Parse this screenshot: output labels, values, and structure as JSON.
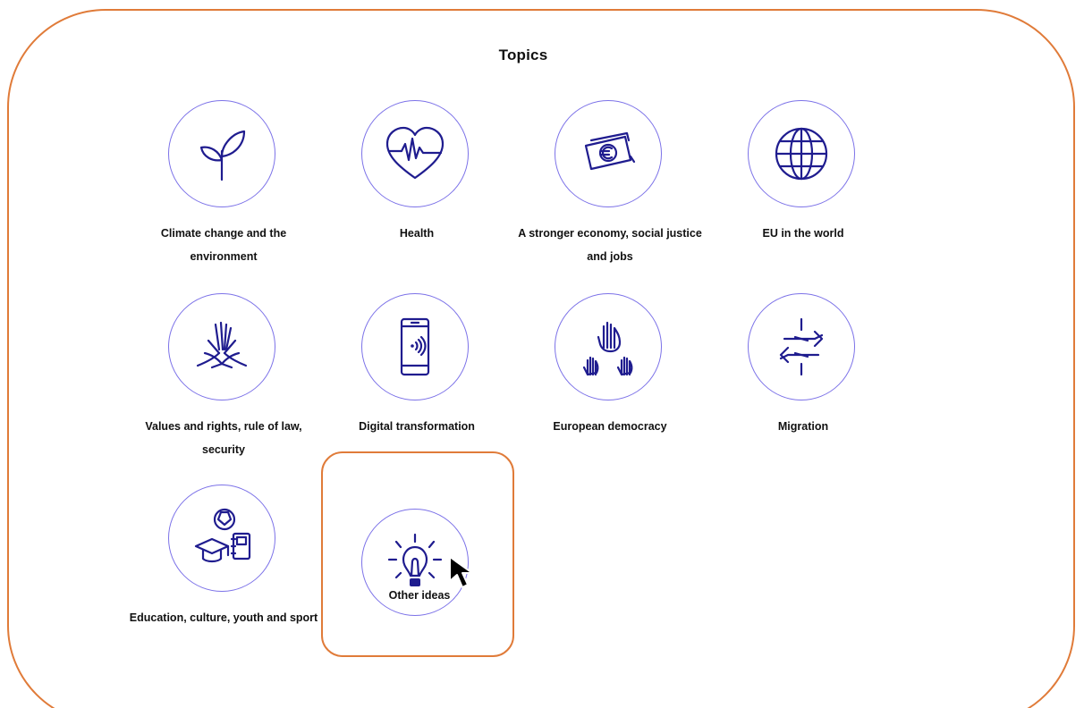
{
  "page": {
    "title": "Topics"
  },
  "colors": {
    "frame": "#e07b39",
    "circle": "#7c72e8",
    "icon": "#1f1c8f"
  },
  "topics": [
    {
      "label": "Climate change and the environment",
      "icon": "sprout-icon"
    },
    {
      "label": "Health",
      "icon": "heart-pulse-icon"
    },
    {
      "label": "A stronger economy, social justice and jobs",
      "icon": "euro-banknotes-icon"
    },
    {
      "label": "EU in the world",
      "icon": "globe-icon"
    },
    {
      "label": "Values and rights, rule of law, security",
      "icon": "joined-hands-icon"
    },
    {
      "label": "Digital transformation",
      "icon": "smartphone-nfc-icon"
    },
    {
      "label": "European democracy",
      "icon": "raised-hands-icon"
    },
    {
      "label": "Migration",
      "icon": "exchange-arrows-icon"
    },
    {
      "label": "Education, culture, youth and sport",
      "icon": "education-icon"
    },
    {
      "label": "Other ideas",
      "icon": "lightbulb-icon",
      "selected": true
    }
  ],
  "cursor": {
    "icon": "mouse-pointer-icon"
  }
}
